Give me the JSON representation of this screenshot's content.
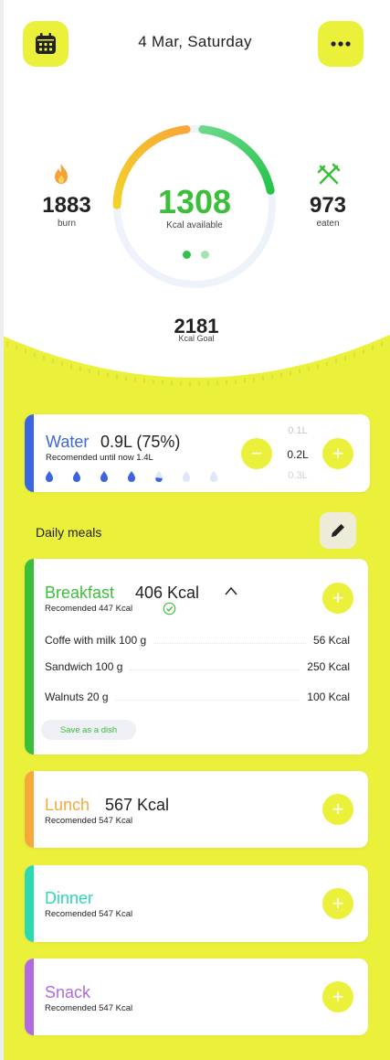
{
  "header": {
    "date": "4 Mar, Saturday",
    "calendar_icon": "calendar-icon",
    "menu_icon": "more-horizontal-icon"
  },
  "summary": {
    "burn_value": "1883",
    "burn_label": "burn",
    "available_value": "1308",
    "available_label": "Kcal available",
    "eaten_value": "973",
    "eaten_label": "eaten",
    "goal_value": "2181",
    "goal_label": "Kcal Goal",
    "ring_burn_fraction": 0.23,
    "ring_eaten_fraction": 0.2,
    "page_indicator_active": 0,
    "page_indicator_count": 2
  },
  "water": {
    "title": "Water",
    "amount": "0.9L (75%)",
    "recommended": "Recomended until now 1.4L",
    "drops_total": 7,
    "drops_full": 4,
    "drops_half": 1,
    "picker_options": [
      "0.1L",
      "0.2L",
      "0.3L"
    ],
    "picker_selected": "0.2L",
    "minus_label": "−",
    "plus_label": "+"
  },
  "daily_meals": {
    "title": "Daily meals",
    "edit_icon": "pencil-icon"
  },
  "meals": {
    "breakfast": {
      "name": "Breakfast",
      "kcal": "406 Kcal",
      "recommended": "Recomended 447 Kcal",
      "expanded": true,
      "items": [
        {
          "name": "Coffe with milk 100 g",
          "kcal": "56 Kcal"
        },
        {
          "name": "Sandwich 100 g",
          "kcal": "250 Kcal"
        },
        {
          "name": "Walnuts 20 g",
          "kcal": "100 Kcal"
        }
      ],
      "save_label": "Save as a dish"
    },
    "lunch": {
      "name": "Lunch",
      "kcal": "567 Kcal",
      "recommended": "Recomended 547 Kcal"
    },
    "dinner": {
      "name": "Dinner",
      "recommended": "Recomended 547 Kcal"
    },
    "snack": {
      "name": "Snack",
      "recommended": "Recomended 547 Kcal"
    }
  },
  "colors": {
    "accent_yellow": "#ebf03a",
    "green": "#3bbf3a",
    "orange": "#f5a93a",
    "blue": "#3c66e0",
    "teal": "#2ed8b0",
    "purple": "#b06be0"
  }
}
